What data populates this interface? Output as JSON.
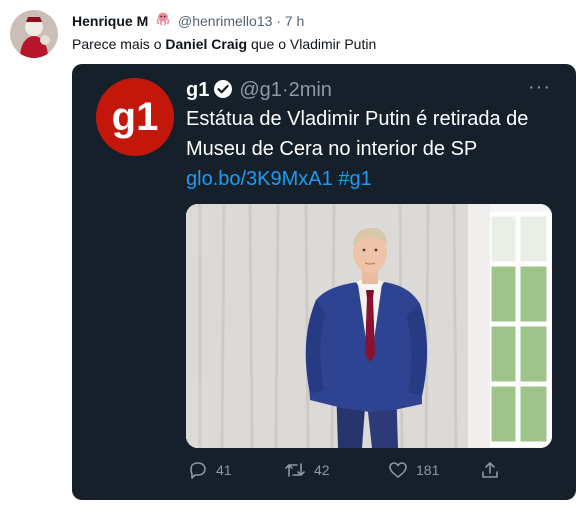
{
  "outer_tweet": {
    "display_name": "Henrique M",
    "handle": "@henrimello13",
    "separator": "·",
    "time": "7 h",
    "text_before": "Parece mais o ",
    "text_bold": "Daniel Craig",
    "text_after": " que o Vladimir Putin"
  },
  "quoted_tweet": {
    "logo_text": "g1",
    "display_name": "g1",
    "handle": "@g1",
    "separator": "·",
    "time": "2min",
    "text": "Estátua de Vladimir Putin é retirada de Museu de Cera no interior de SP",
    "link": "glo.bo/3K9MxA1",
    "hashtag": "#g1",
    "replies": "41",
    "retweets": "42",
    "likes": "181"
  },
  "icons": {
    "avatar": "avatar-icon",
    "octopus": "octopus-emoji-icon",
    "verified": "verified-badge-icon",
    "more": "more-options-icon",
    "reply": "reply-icon",
    "retweet": "retweet-icon",
    "like": "heart-icon",
    "share": "share-icon"
  },
  "colors": {
    "card_background": "#15202b",
    "link": "#1d9bf0",
    "g1_brand": "#c4170c",
    "muted": "#8b98a5"
  }
}
